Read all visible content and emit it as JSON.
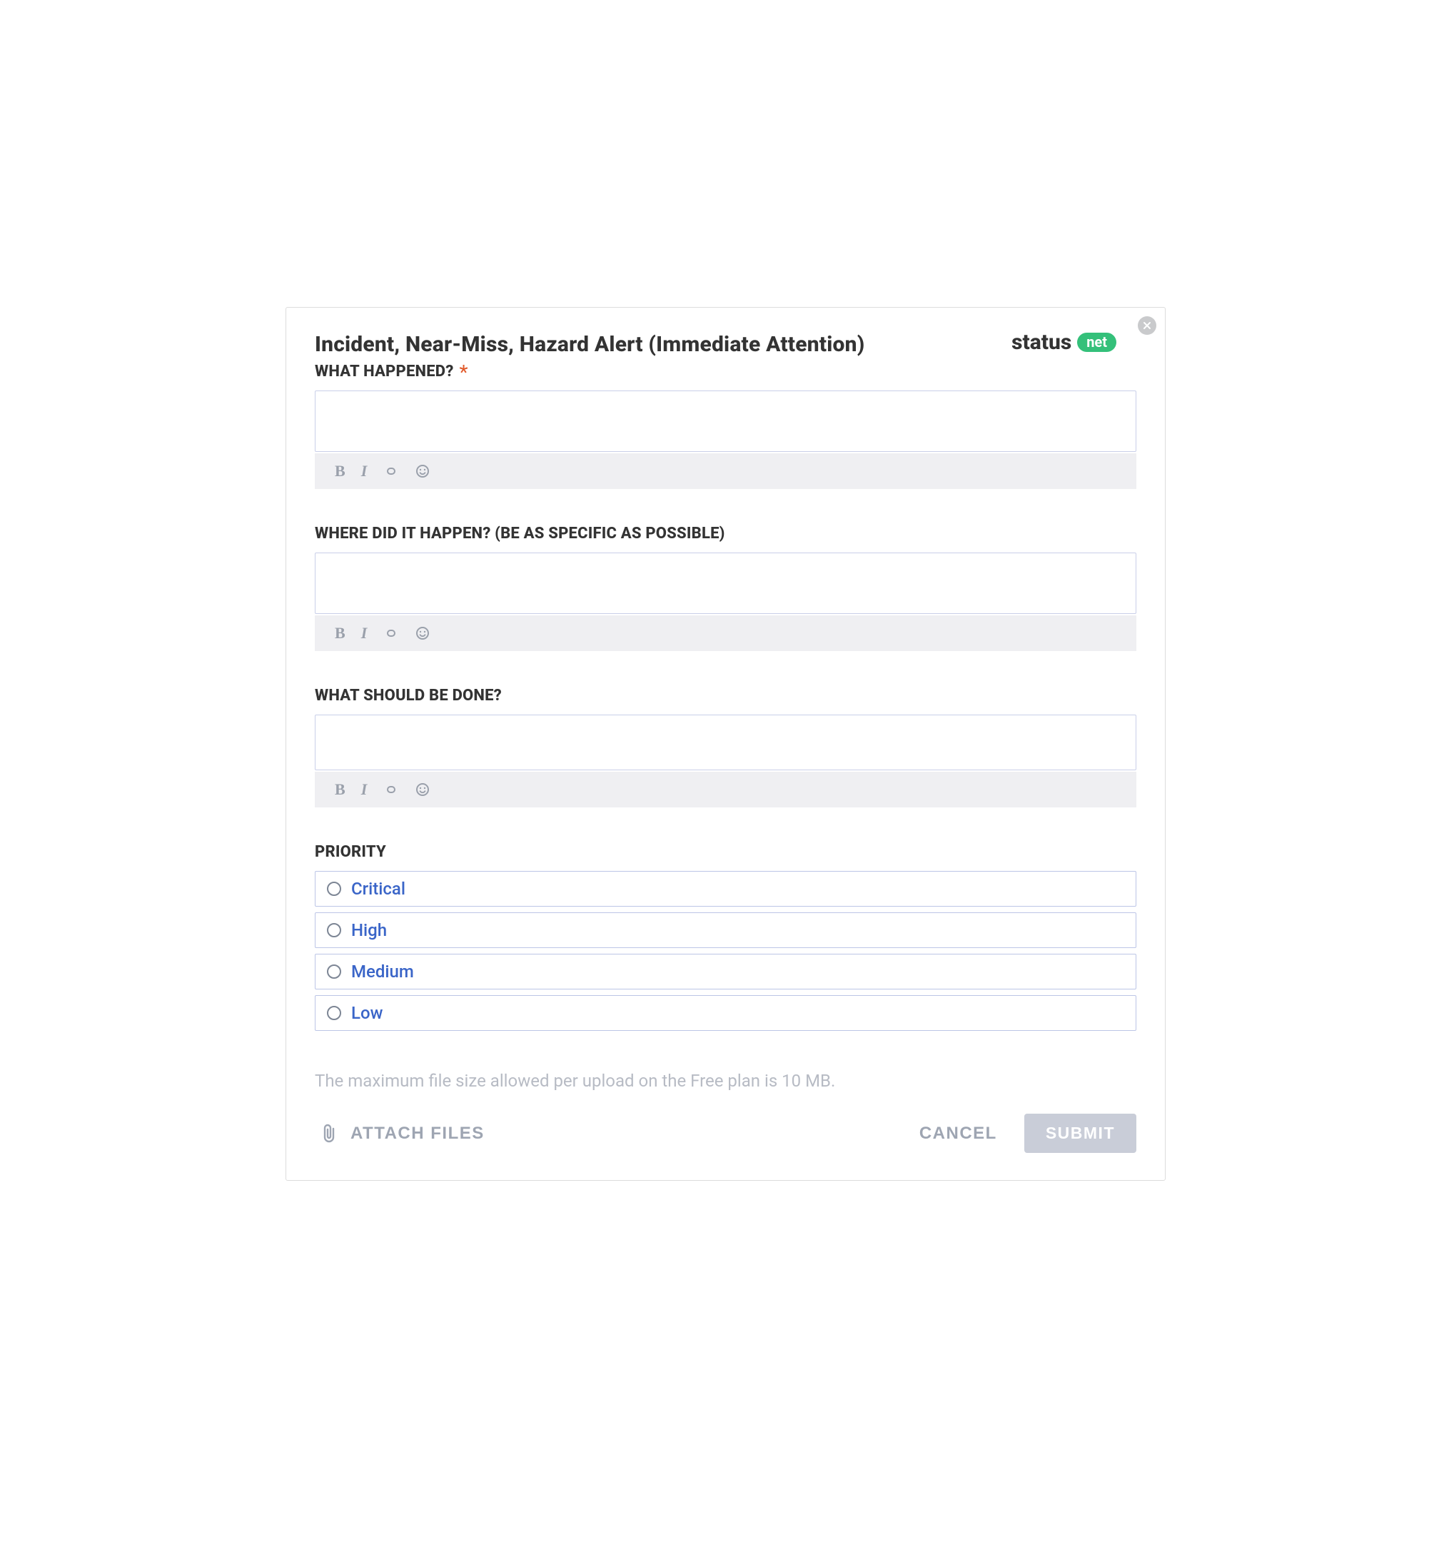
{
  "brand": {
    "text": "status",
    "pill": "net"
  },
  "form": {
    "title": "Incident, Near-Miss, Hazard Alert (Immediate Attention)",
    "required_glyph": "*"
  },
  "sections": [
    {
      "id": "what-happened",
      "label": "WHAT HAPPENED?",
      "required": true
    },
    {
      "id": "where",
      "label": "WHERE DID IT HAPPEN? (BE AS SPECIFIC AS POSSIBLE)",
      "required": false
    },
    {
      "id": "what-done",
      "label": "WHAT SHOULD BE DONE?",
      "required": false
    },
    {
      "id": "priority",
      "label": "PRIORITY",
      "required": false
    }
  ],
  "toolbar": {
    "bold": "B",
    "italic": "I"
  },
  "priority": {
    "options": [
      "Critical",
      "High",
      "Medium",
      "Low"
    ],
    "selected": null
  },
  "upload": {
    "note": "The maximum file size allowed per upload on the Free plan is 10 MB."
  },
  "actions": {
    "attach": "ATTACH FILES",
    "cancel": "CANCEL",
    "submit": "SUBMIT"
  },
  "colors": {
    "accent_green": "#34c07a",
    "required": "#e15a2b",
    "link_blue": "#3a65c8",
    "muted": "#9ea5b2",
    "toolbar_bg": "#efeff2",
    "input_border": "#c9cfe8"
  }
}
